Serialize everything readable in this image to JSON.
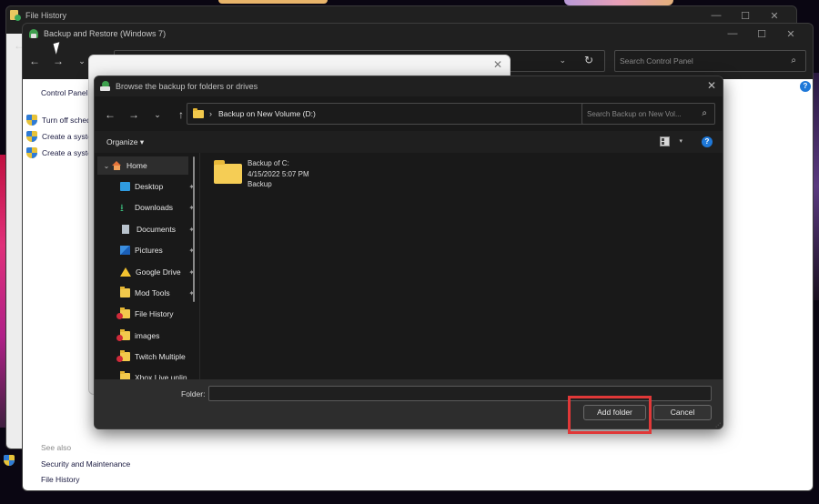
{
  "windows": {
    "file_history": {
      "title": "File History",
      "back_glyph": "←",
      "caption": [
        "—",
        "☐",
        "✕"
      ]
    },
    "backup_restore": {
      "title": "Backup and Restore (Windows 7)",
      "caption": [
        "—",
        "☐",
        "✕"
      ],
      "nav": {
        "back": "←",
        "forward": "→",
        "recent": "⌄"
      },
      "address_chevron": "⌄",
      "refresh_glyph": "↻",
      "search_placeholder": "Search Control Panel",
      "search_glyph": "⌕",
      "help_glyph": "?",
      "sidebar": {
        "home_link": "Control Panel Home",
        "links": [
          {
            "label": "Turn off schedule",
            "icon": "shield-icon"
          },
          {
            "label": "Create a system image",
            "icon": "shield-icon"
          },
          {
            "label": "Create a system repair disc",
            "icon": "shield-icon"
          }
        ],
        "see_also_label": "See also",
        "see_also_links": [
          "Security and Maintenance",
          "File History"
        ]
      }
    },
    "white_popup": {
      "close_glyph": "✕"
    },
    "browse_dialog": {
      "title": "Browse the backup for folders or drives",
      "close_glyph": "✕",
      "nav": {
        "back": "←",
        "forward": "→",
        "recent": "⌄",
        "up": "↑"
      },
      "address": {
        "separator": "›",
        "path": "Backup on New Volume (D:)",
        "chevron": "⌄",
        "refresh": "↻"
      },
      "search_placeholder": "Search Backup on New Vol...",
      "search_glyph": "⌕",
      "command_bar": {
        "organize_label": "Organize ▾",
        "view_dropdown": "▾",
        "help_glyph": "?"
      },
      "nav_pane": {
        "home": {
          "label": "Home",
          "expander": "⌄"
        },
        "items": [
          {
            "label": "Desktop",
            "icon": "desktop-icon",
            "pinned": true,
            "error": false
          },
          {
            "label": "Downloads",
            "icon": "downloads-icon",
            "pinned": true,
            "error": false
          },
          {
            "label": "Documents",
            "icon": "documents-icon",
            "pinned": true,
            "error": false
          },
          {
            "label": "Pictures",
            "icon": "pictures-icon",
            "pinned": true,
            "error": false
          },
          {
            "label": "Google Drive",
            "icon": "google-drive-icon",
            "pinned": true,
            "error": false
          },
          {
            "label": "Mod Tools",
            "icon": "folder-icon",
            "pinned": true,
            "error": false
          },
          {
            "label": "File History",
            "icon": "folder-icon",
            "pinned": false,
            "error": true
          },
          {
            "label": "images",
            "icon": "folder-icon",
            "pinned": false,
            "error": true
          },
          {
            "label": "Twitch Multiple",
            "icon": "folder-icon",
            "pinned": false,
            "error": true
          },
          {
            "label": "Xbox Live unlin",
            "icon": "folder-icon",
            "pinned": false,
            "error": false
          }
        ],
        "pin_glyph": "📌"
      },
      "files": [
        {
          "name": "Backup of C:",
          "date": "4/15/2022 5:07 PM",
          "type": "Backup"
        }
      ],
      "footer": {
        "folder_label": "Folder:",
        "folder_value": "",
        "add_button": "Add folder",
        "cancel_button": "Cancel"
      }
    }
  },
  "accent_colors": {
    "highlight_box": "#e03838",
    "help_blue": "#1e78d8",
    "folder_yellow": "#f5cd55"
  }
}
